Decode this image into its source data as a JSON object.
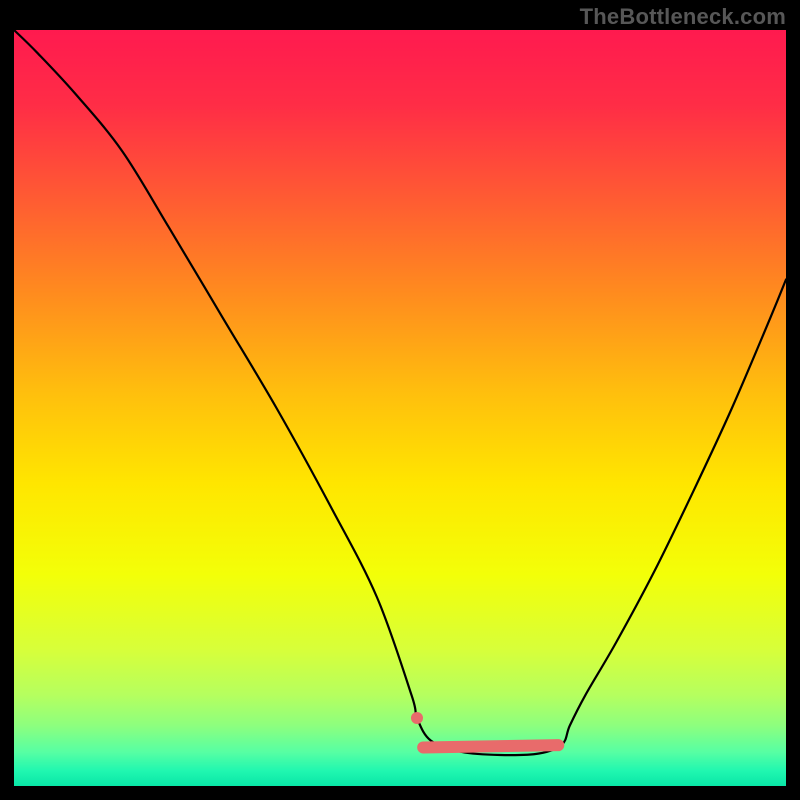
{
  "watermark": "TheBottleneck.com",
  "chart_data": {
    "type": "line",
    "title": "",
    "xlabel": "",
    "ylabel": "",
    "xlim": [
      0,
      100
    ],
    "ylim": [
      0,
      100
    ],
    "background_gradient": {
      "stops": [
        {
          "offset": 0.0,
          "color": "#ff1a4f"
        },
        {
          "offset": 0.1,
          "color": "#ff2d46"
        },
        {
          "offset": 0.22,
          "color": "#ff5a33"
        },
        {
          "offset": 0.35,
          "color": "#ff8c1e"
        },
        {
          "offset": 0.48,
          "color": "#ffbf0d"
        },
        {
          "offset": 0.6,
          "color": "#ffe600"
        },
        {
          "offset": 0.72,
          "color": "#f3ff08"
        },
        {
          "offset": 0.82,
          "color": "#d7ff3a"
        },
        {
          "offset": 0.88,
          "color": "#b5ff5f"
        },
        {
          "offset": 0.92,
          "color": "#8dff7e"
        },
        {
          "offset": 0.955,
          "color": "#57ffa3"
        },
        {
          "offset": 0.98,
          "color": "#20f7b0"
        },
        {
          "offset": 1.0,
          "color": "#09e6a7"
        }
      ]
    },
    "series": [
      {
        "name": "bottleneck-curve",
        "color": "#000000",
        "width": 2.2,
        "x": [
          0,
          3,
          8,
          14,
          20,
          27,
          34,
          41,
          47,
          51.5,
          52.2,
          54,
          58,
          63,
          68,
          71,
          72,
          74,
          78,
          83,
          88,
          93,
          98,
          100
        ],
        "y": [
          100,
          97,
          91.5,
          84,
          74,
          62,
          50,
          37,
          25,
          12,
          9,
          6.0,
          4.5,
          4.1,
          4.3,
          5.5,
          8,
          12,
          19,
          28.5,
          39,
          50,
          62,
          67
        ]
      }
    ],
    "annotations": [
      {
        "name": "optimal-band",
        "type": "thick-segment",
        "color": "#e86b6b",
        "width": 12,
        "cap": "round",
        "x": [
          53.0,
          70.5
        ],
        "y": [
          5.1,
          5.4
        ]
      },
      {
        "name": "marker-dot",
        "type": "dot",
        "color": "#e86b6b",
        "radius": 6,
        "x": 52.2,
        "y": 9.0
      }
    ]
  }
}
